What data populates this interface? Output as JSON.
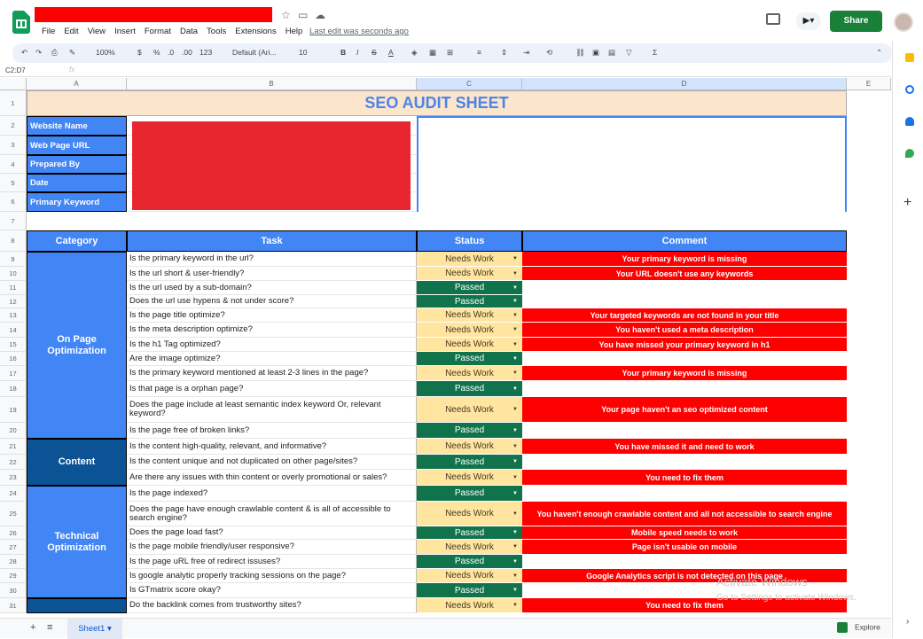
{
  "app": {
    "last_edit": "Last edit was seconds ago",
    "share_label": "Share",
    "menu": [
      "File",
      "Edit",
      "View",
      "Insert",
      "Format",
      "Data",
      "Tools",
      "Extensions",
      "Help"
    ]
  },
  "toolbar": {
    "zoom": "100%",
    "currency": "$",
    "percent": "%",
    "dec1": ".0",
    "dec2": ".00",
    "format": "123",
    "font": "Default (Ari...",
    "size": "10"
  },
  "formula_bar": {
    "cell_ref": "C2:D7",
    "fx": "fx"
  },
  "columns": [
    "A",
    "B",
    "C",
    "D",
    "E"
  ],
  "sheet": {
    "title": "SEO AUDIT SHEET",
    "info_labels": [
      "Website Name",
      "Web Page URL",
      "Prepared By",
      "Date",
      "Primary Keyword"
    ],
    "headers": {
      "category": "Category",
      "task": "Task",
      "status": "Status",
      "comment": "Comment"
    },
    "categories": [
      "On Page Optimization",
      "Content",
      "Technical Optimization"
    ],
    "rows": [
      {
        "n": "9",
        "task": "Is the primary keyword in the url?",
        "status": "Needs Work",
        "comment": "Your primary keyword is missing"
      },
      {
        "n": "10",
        "task": "Is the url short & user-friendly?",
        "status": "Needs Work",
        "comment": "Your URL doesn't use any keywords"
      },
      {
        "n": "11",
        "task": "Is the url used by a sub-domain?",
        "status": "Passed",
        "comment": ""
      },
      {
        "n": "12",
        "task": "Does the url use hypens & not under score?",
        "status": "Passed",
        "comment": ""
      },
      {
        "n": "13",
        "task": "Is the page title optimize?",
        "status": "Needs Work",
        "comment": "Your targeted keywords are not found in your title"
      },
      {
        "n": "14",
        "task": "Is the meta description optimize?",
        "status": "Needs Work",
        "comment": "You haven't used a meta description"
      },
      {
        "n": "15",
        "task": "Is the h1 Tag optimized?",
        "status": "Needs Work",
        "comment": "You have missed your primary keyword in h1"
      },
      {
        "n": "16",
        "task": "Are the image optimize?",
        "status": "Passed",
        "comment": ""
      },
      {
        "n": "17",
        "task": "Is the primary keyword mentioned at least 2-3 lines in the page?",
        "status": "Needs Work",
        "comment": "Your primary keyword is missing"
      },
      {
        "n": "18",
        "task": "Is that page is a orphan page?",
        "status": "Passed",
        "comment": ""
      },
      {
        "n": "19",
        "task": "Does the page include at least semantic index keyword Or, relevant keyword?",
        "status": "Needs Work",
        "comment": "Your page haven't an seo optimized content"
      },
      {
        "n": "20",
        "task": "Is the page free of broken links?",
        "status": "Passed",
        "comment": ""
      },
      {
        "n": "21",
        "task": "Is the content high-quality, relevant, and informative?",
        "status": "Needs Work",
        "comment": "You have missed it and need to work"
      },
      {
        "n": "22",
        "task": "Is the content unique and not duplicated on other page/sites?",
        "status": "Passed",
        "comment": ""
      },
      {
        "n": "23",
        "task": "Are there any issues with thin content or overly promotional or sales?",
        "status": "Needs Work",
        "comment": "You need to fix them"
      },
      {
        "n": "24",
        "task": "Is the page indexed?",
        "status": "Passed",
        "comment": ""
      },
      {
        "n": "25",
        "task": "Does the page have enough crawlable content & is all of accessible to search engine?",
        "status": "Needs Work",
        "comment": "You haven't enough crawlable content and all not accessible to search engine"
      },
      {
        "n": "26",
        "task": "Does the page load fast?",
        "status": "Passed",
        "comment": "Mobile speed needs to work"
      },
      {
        "n": "27",
        "task": "Is the page mobile friendly/user responsive?",
        "status": "Needs Work",
        "comment": "Page isn't usable on mobile"
      },
      {
        "n": "28",
        "task": "Is the page uRL free of redirect issuses?",
        "status": "Passed",
        "comment": ""
      },
      {
        "n": "29",
        "task": "Is google analytic properly tracking sessions on the page?",
        "status": "Needs Work",
        "comment": "Google Analytics script is not detected on this page"
      },
      {
        "n": "30",
        "task": "Is GTmatrix score okay?",
        "status": "Passed",
        "comment": ""
      },
      {
        "n": "31",
        "task": "Do the backlink comes from trustworthy sites?",
        "status": "Needs Work",
        "comment": "You need to fix them"
      }
    ]
  },
  "tabs": {
    "sheet1": "Sheet1",
    "explore": "Explore"
  },
  "watermark": {
    "line1": "Activate Windows",
    "line2": "Go to Settings to activate Windows."
  }
}
